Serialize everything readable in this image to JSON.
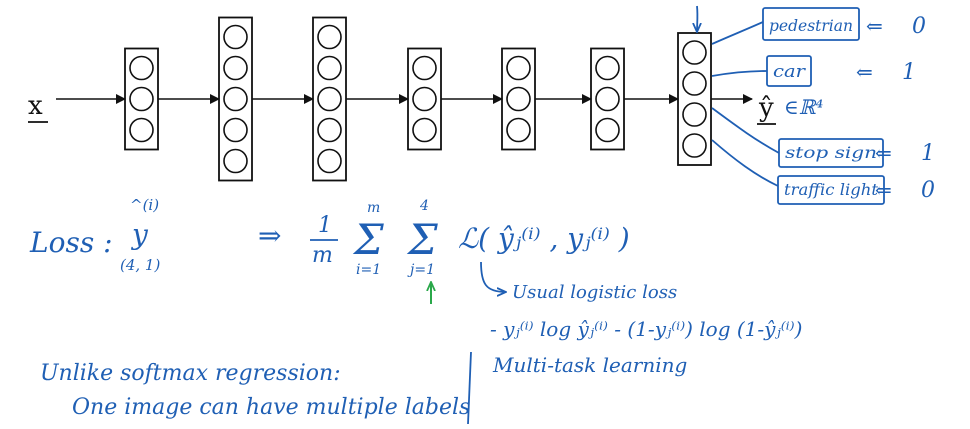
{
  "colors": {
    "ink": "#111111",
    "pen_blue": "#1f5fb4",
    "pen_green": "#2aa84a"
  },
  "network": {
    "input_label": "x",
    "output_label": "ŷ",
    "output_space": "∈ℝ⁴",
    "layer_unit_counts": [
      3,
      5,
      5,
      3,
      3,
      3,
      4
    ]
  },
  "outputs": [
    {
      "name": "pedestrian",
      "value": "0"
    },
    {
      "name": "car",
      "value": "1"
    },
    {
      "name": "stop sign",
      "value": "1"
    },
    {
      "name": "traffic light",
      "value": "0"
    }
  ],
  "loss": {
    "label": "Loss :",
    "y_symbol": "y",
    "y_superscript": "^(i)",
    "y_shape": "(4, 1)",
    "implies": "⇒",
    "fraction_num": "1",
    "fraction_den": "m",
    "outer_sum_top": "m",
    "outer_sum_bottom": "i=1",
    "inner_sum_top": "4",
    "inner_sum_bottom": "j=1",
    "loss_term": "ℒ( ŷⱼ⁽ⁱ⁾ , yⱼ⁽ⁱ⁾ )",
    "usual_note": "Usual logistic loss",
    "logistic_formula": "- yⱼ⁽ⁱ⁾ log ŷⱼ⁽ⁱ⁾ - (1-yⱼ⁽ⁱ⁾) log (1-ŷⱼ⁽ⁱ⁾)"
  },
  "notes": {
    "unlike_line1": "Unlike softmax regression:",
    "unlike_line2": "One image can have multiple labels",
    "multitask": "Multi-task learning"
  }
}
